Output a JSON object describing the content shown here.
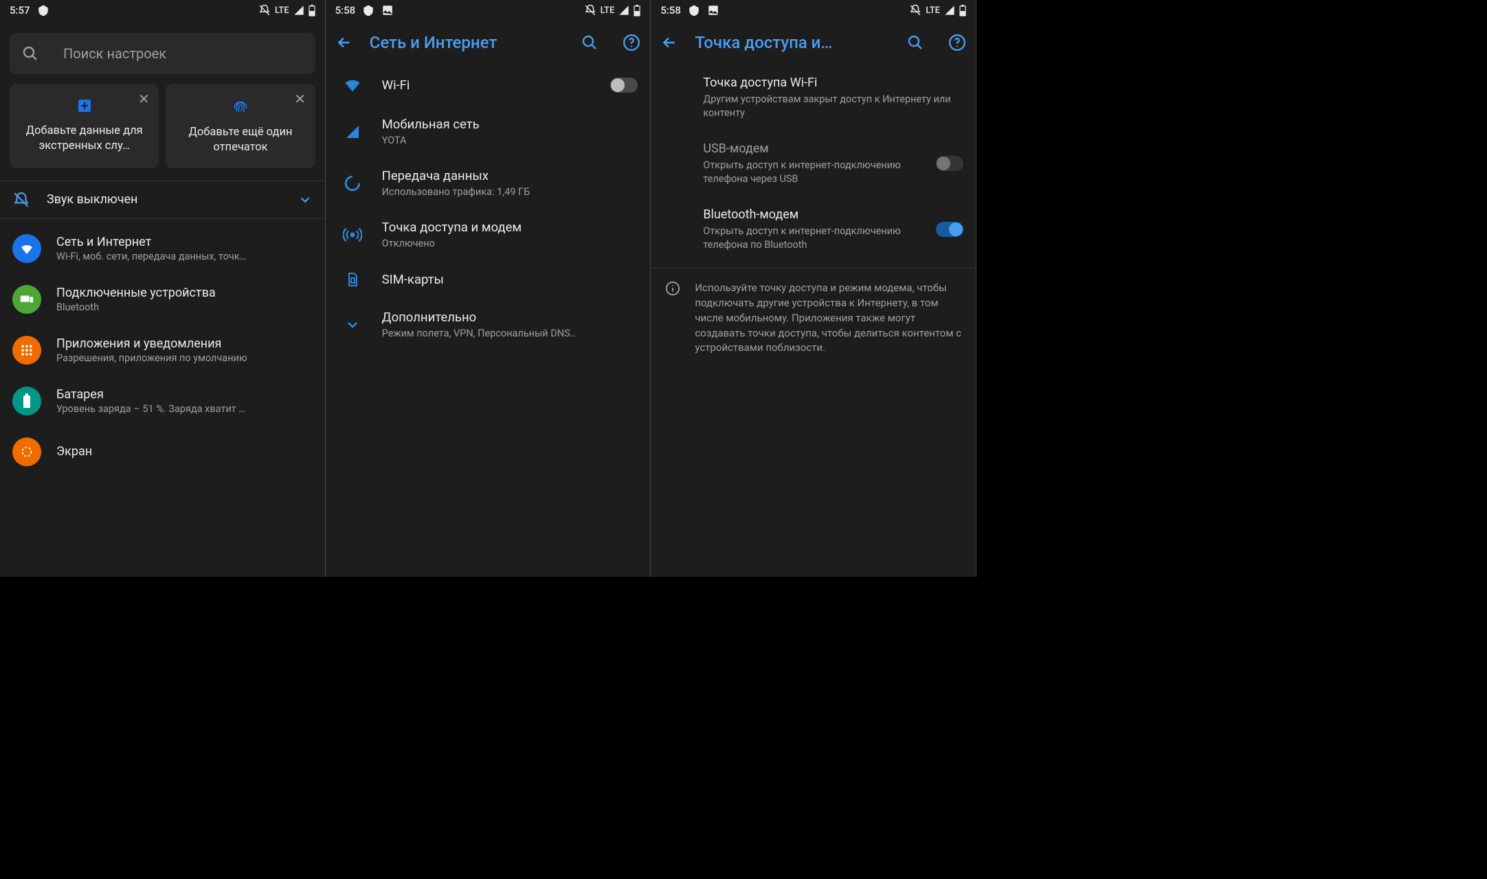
{
  "screen1": {
    "time": "5:57",
    "lte": "LTE",
    "search_placeholder": "Поиск настроек",
    "card1_text": "Добавьте данные для экстренных слу…",
    "card2_text": "Добавьте ещё один отпечаток",
    "sound_row": "Звук выключен",
    "items": [
      {
        "title": "Сеть и Интернет",
        "sub": "Wi-Fi, моб. сети, передача данных, точк…",
        "bg": "#1a73e8"
      },
      {
        "title": "Подключенные устройства",
        "sub": "Bluetooth",
        "bg": "#4da635"
      },
      {
        "title": "Приложения и уведомления",
        "sub": "Разрешения, приложения по умолчанию",
        "bg": "#ef6c00"
      },
      {
        "title": "Батарея",
        "sub": "Уровень заряда – 51 %. Заряда хватит …",
        "bg": "#009688"
      },
      {
        "title": "Экран",
        "sub": "",
        "bg": "#ef6c00"
      }
    ]
  },
  "screen2": {
    "time": "5:58",
    "lte": "LTE",
    "title": "Сеть и Интернет",
    "wifi_label": "Wi-Fi",
    "mobile": {
      "title": "Мобильная сеть",
      "sub": "YOTA"
    },
    "data": {
      "title": "Передача данных",
      "sub": "Использовано трафика: 1,49 ГБ"
    },
    "hotspot": {
      "title": "Точка доступа и модем",
      "sub": "Отключено"
    },
    "sim": "SIM-карты",
    "advanced": {
      "title": "Дополнительно",
      "sub": "Режим полета, VPN, Персональный DNS.."
    }
  },
  "screen3": {
    "time": "5:58",
    "lte": "LTE",
    "title": "Точка доступа и…",
    "wifi_hotspot": {
      "title": "Точка доступа Wi-Fi",
      "sub": "Другим устройствам закрыт доступ к Интернету или контенту"
    },
    "usb": {
      "title": "USB-модем",
      "sub": "Открыть доступ к интернет-подключению телефона через USB"
    },
    "bt": {
      "title": "Bluetooth-модем",
      "sub": "Открыть доступ к интернет-подключению телефона по Bluetooth"
    },
    "info": "Используйте точку доступа и режим модема, чтобы подключать другие устройства к Интернету, в том числе мобильному. Приложения также могут создавать точки доступа, чтобы делиться контентом с устройствами поблизости."
  }
}
